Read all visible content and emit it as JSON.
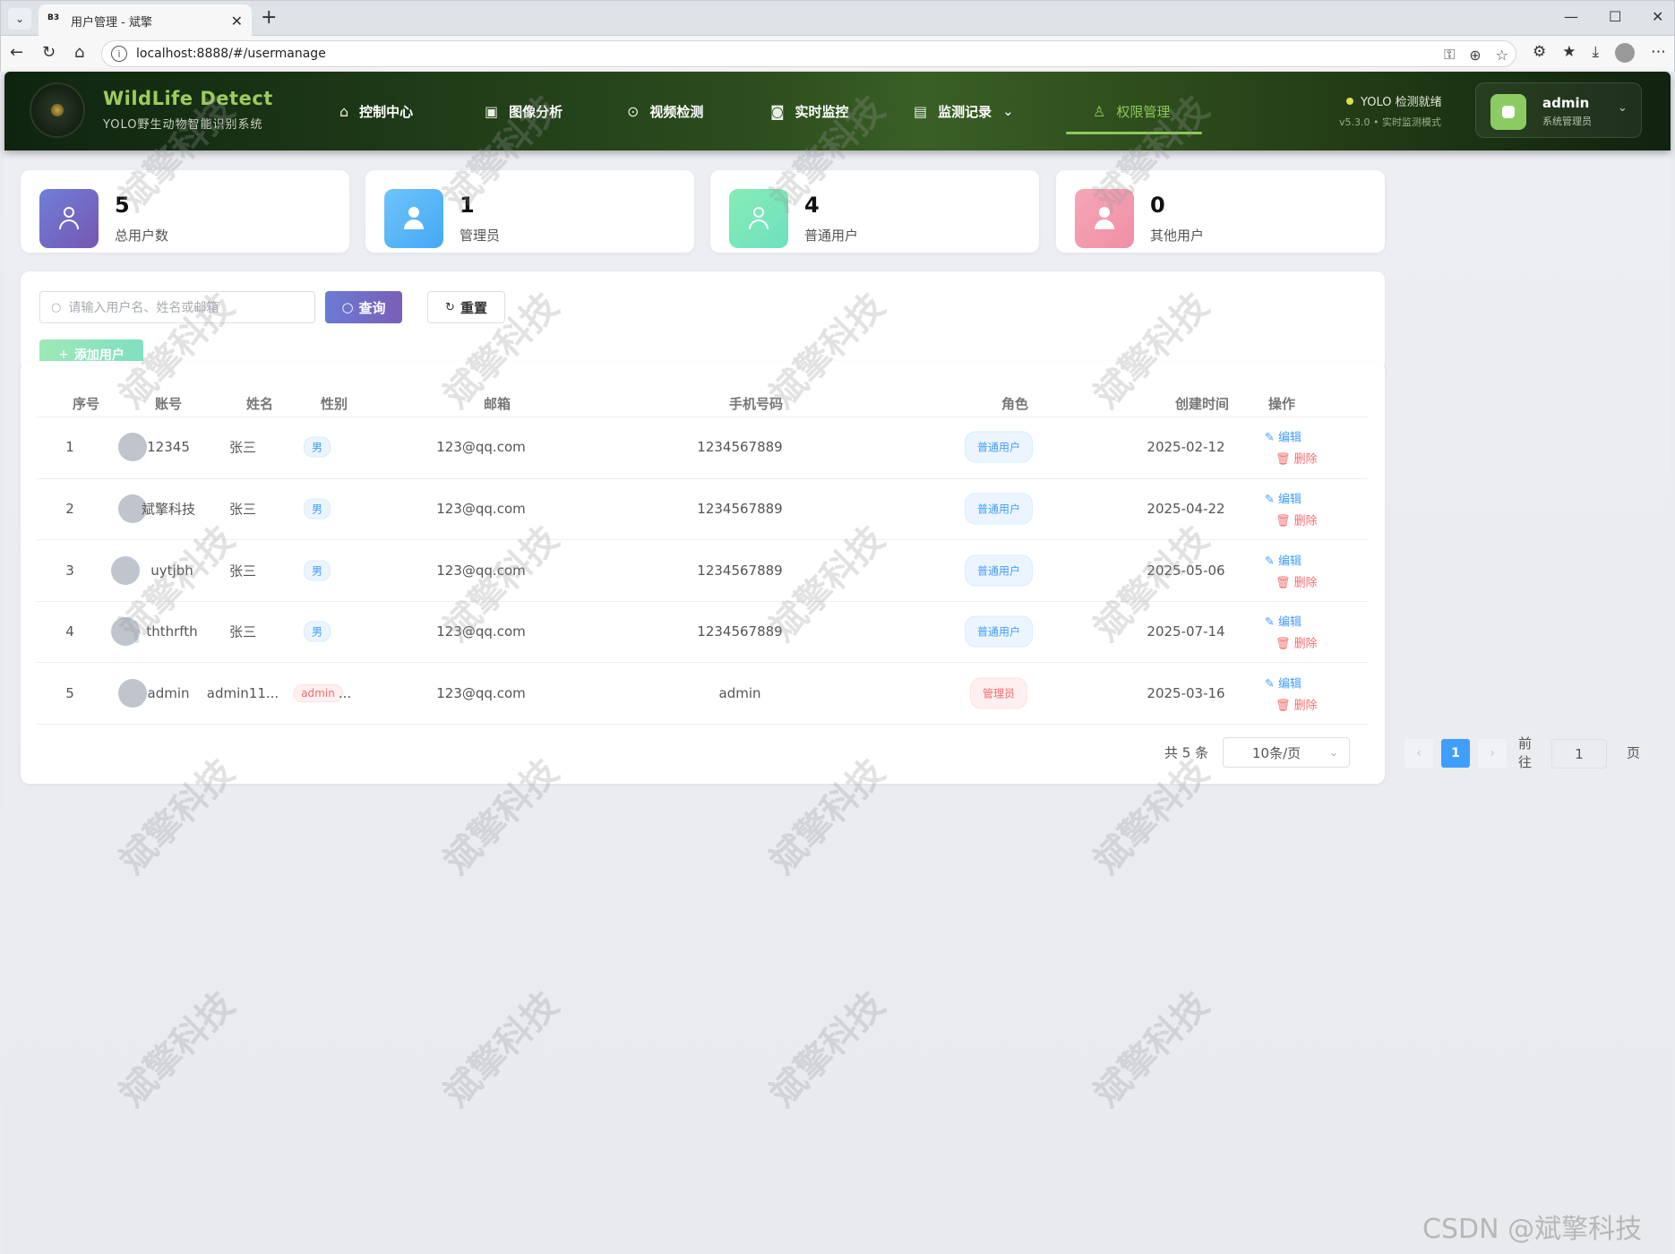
{
  "browser": {
    "tab_favicon": "B3",
    "tab_title": "用户管理 - 斌擎",
    "url": "localhost:8888/#/usermanage"
  },
  "header": {
    "brand_title": "WildLife Detect",
    "brand_subtitle": "YOLO野生动物智能识别系统",
    "nav": [
      {
        "label": "控制中心",
        "icon": "home-icon"
      },
      {
        "label": "图像分析",
        "icon": "image-icon"
      },
      {
        "label": "视频检测",
        "icon": "play-icon"
      },
      {
        "label": "实时监控",
        "icon": "camera-icon"
      },
      {
        "label": "监测记录",
        "icon": "document-icon"
      },
      {
        "label": "权限管理",
        "icon": "user-icon"
      }
    ],
    "status_text": "YOLO 检测就绪",
    "version_text": "v5.3.0 • 实时监测模式",
    "user_name": "admin",
    "user_role": "系统管理员"
  },
  "stats": [
    {
      "value": "5",
      "label": "总用户数"
    },
    {
      "value": "1",
      "label": "管理员"
    },
    {
      "value": "4",
      "label": "普通用户"
    },
    {
      "value": "0",
      "label": "其他用户"
    }
  ],
  "filter": {
    "search_placeholder": "请输入用户名、姓名或邮箱",
    "query_label": "查询",
    "reset_label": "重置",
    "add_label": "添加用户"
  },
  "table": {
    "headers": [
      "序号",
      "账号",
      "姓名",
      "性别",
      "邮箱",
      "手机号码",
      "角色",
      "创建时间",
      "操作"
    ],
    "rows": [
      {
        "index": "1",
        "account": "12345",
        "name": "张三",
        "gender": "男",
        "email": "123@qq.com",
        "phone": "1234567889",
        "role": "普通用户",
        "created": "2025-02-12"
      },
      {
        "index": "2",
        "account": "斌擎科技",
        "name": "张三",
        "gender": "男",
        "email": "123@qq.com",
        "phone": "1234567889",
        "role": "普通用户",
        "created": "2025-04-22"
      },
      {
        "index": "3",
        "account": "uytjbh",
        "name": "张三",
        "gender": "男",
        "email": "123@qq.com",
        "phone": "1234567889",
        "role": "普通用户",
        "created": "2025-05-06"
      },
      {
        "index": "4",
        "account": "ththrfth",
        "name": "张三",
        "gender": "男",
        "email": "123@qq.com",
        "phone": "1234567889",
        "role": "普通用户",
        "created": "2025-07-14"
      },
      {
        "index": "5",
        "account": "admin",
        "name": "admin11...",
        "gender": "admin",
        "email": "123@qq.com",
        "phone": "admin",
        "role": "管理员",
        "created": "2025-03-16"
      }
    ],
    "edit_label": "编辑",
    "delete_label": "删除"
  },
  "pagination": {
    "total_text": "共 5 条",
    "page_size": "10条/页",
    "current_page": "1",
    "goto_prefix": "前往",
    "goto_value": "1",
    "goto_suffix": "页"
  },
  "watermark": "斌擎科技",
  "footer_watermark": "CSDN @斌擎科技",
  "colors": {
    "accent": "#8dc85a",
    "primary": "#409eff",
    "danger": "#f56c6c"
  }
}
